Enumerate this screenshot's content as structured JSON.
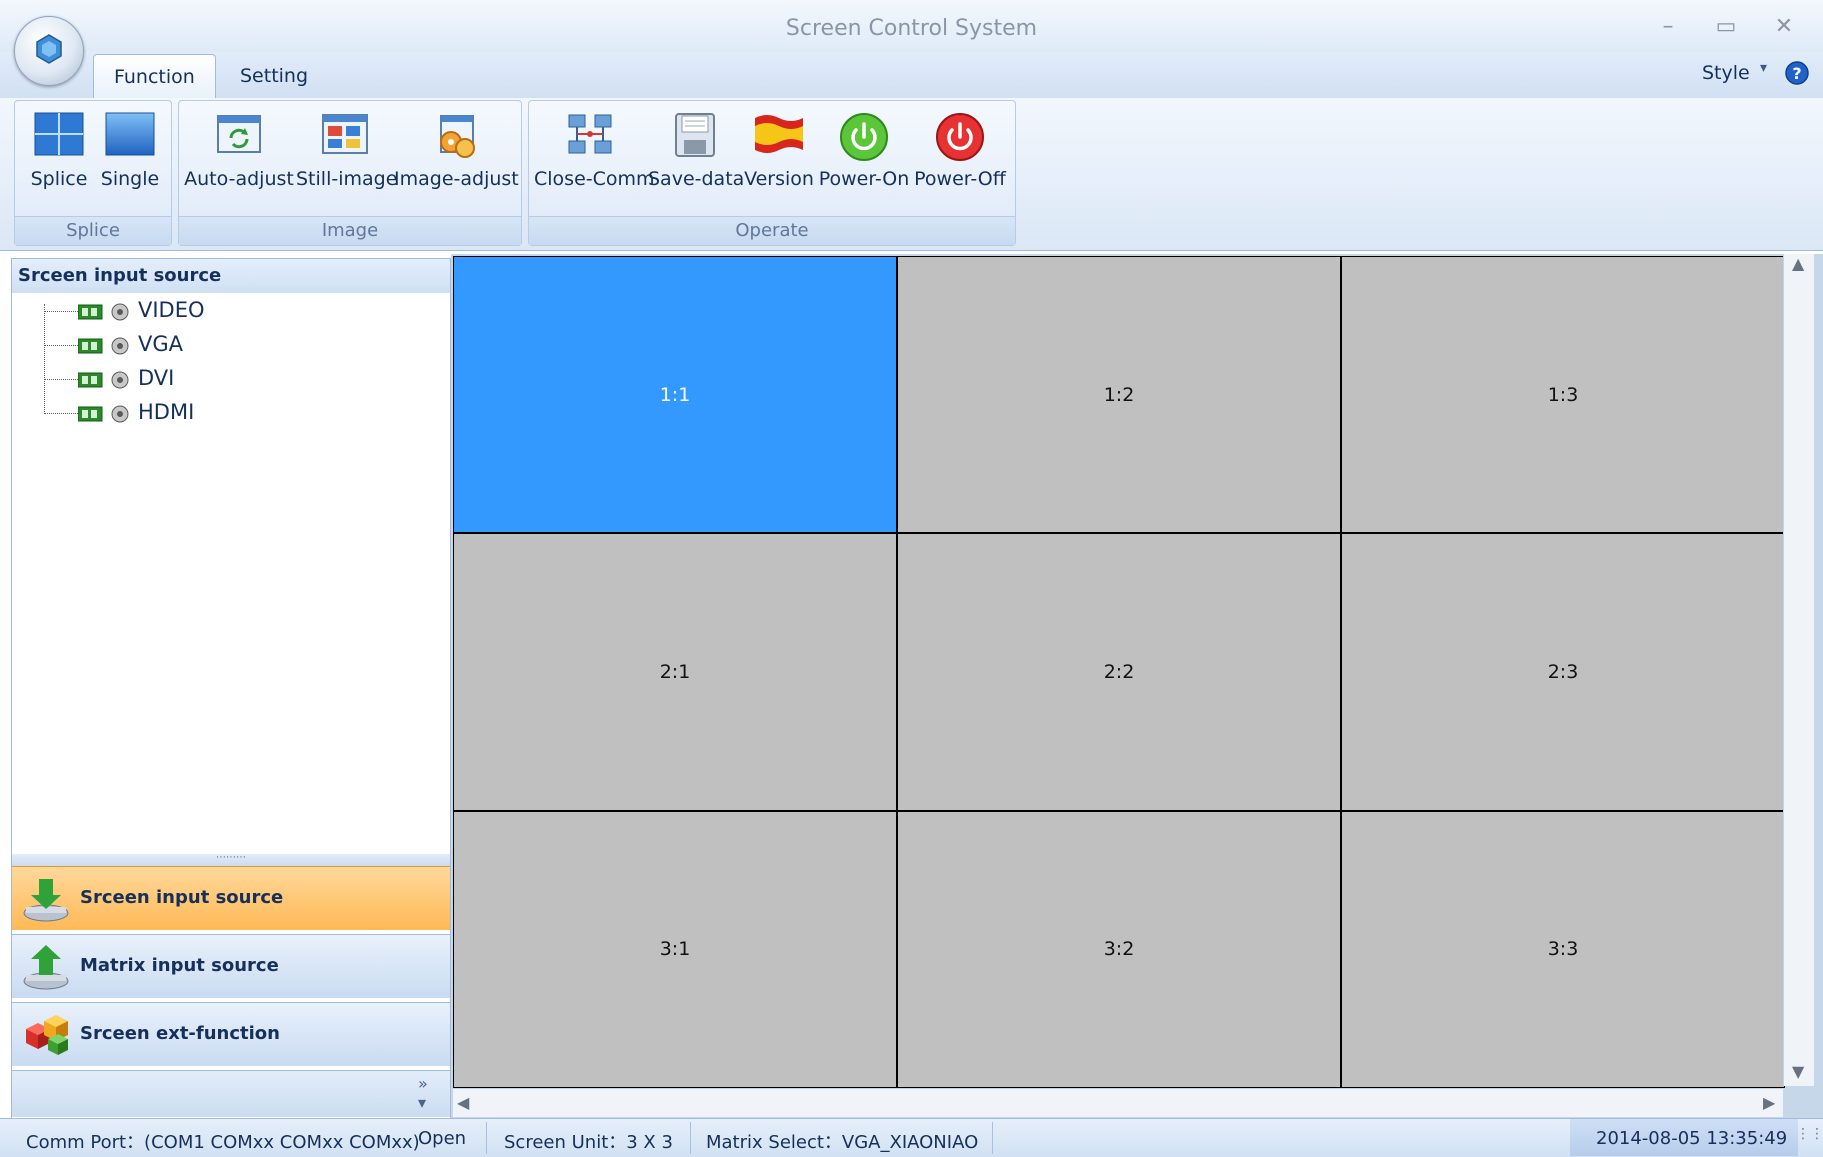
{
  "window": {
    "title": "Screen Control System"
  },
  "tabs": [
    {
      "label": "Function",
      "active": true
    },
    {
      "label": "Setting",
      "active": false
    }
  ],
  "style_menu": {
    "label": "Style"
  },
  "ribbon": {
    "groups": [
      {
        "label": "Splice",
        "buttons": [
          {
            "label": "Splice"
          },
          {
            "label": "Single"
          }
        ]
      },
      {
        "label": "Image",
        "buttons": [
          {
            "label": "Auto-adjust"
          },
          {
            "label": "Still-image"
          },
          {
            "label": "Image-adjust"
          }
        ]
      },
      {
        "label": "Operate",
        "buttons": [
          {
            "label": "Close-Comm"
          },
          {
            "label": "Save-data"
          },
          {
            "label": "Version"
          },
          {
            "label": "Power-On"
          },
          {
            "label": "Power-Off"
          }
        ]
      }
    ]
  },
  "left_panel": {
    "header": "Srceen input source",
    "tree": [
      {
        "label": "VIDEO"
      },
      {
        "label": "VGA"
      },
      {
        "label": "DVI"
      },
      {
        "label": "HDMI"
      }
    ],
    "nav": [
      {
        "label": "Srceen input source",
        "active": true
      },
      {
        "label": "Matrix input source",
        "active": false
      },
      {
        "label": "Srceen ext-function",
        "active": false
      }
    ]
  },
  "grid": {
    "rows": 3,
    "cols": 3,
    "cells": [
      "1:1",
      "1:2",
      "1:3",
      "2:1",
      "2:2",
      "2:3",
      "3:1",
      "3:2",
      "3:3"
    ],
    "selected": "1:1",
    "selected_color": "#3399ff",
    "cell_color": "#c0c0c0"
  },
  "status": {
    "comm_port": "Comm Port：(COM1 COMxx COMxx COMxx)",
    "comm_state": "Open",
    "screen_unit": "Screen Unit：3 X 3",
    "matrix_select": "Matrix Select：VGA_XIAONIAO",
    "datetime": "2014-08-05 13:35:49"
  }
}
